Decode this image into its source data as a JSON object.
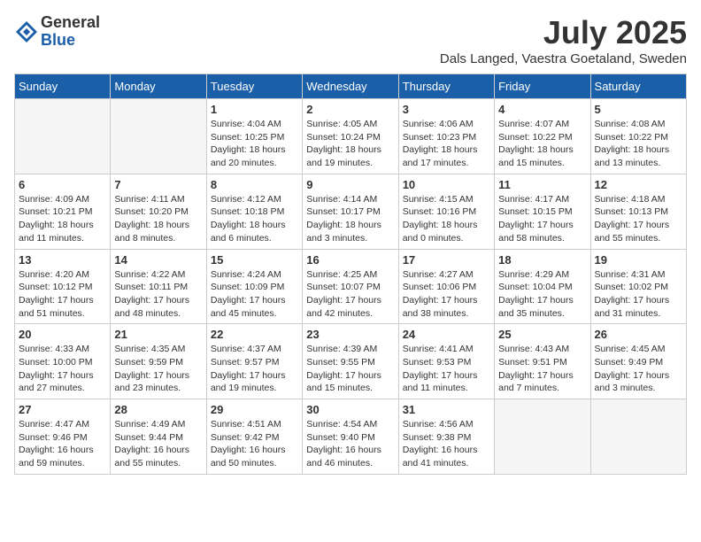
{
  "header": {
    "logo_general": "General",
    "logo_blue": "Blue",
    "month_title": "July 2025",
    "location": "Dals Langed, Vaestra Goetaland, Sweden"
  },
  "weekdays": [
    "Sunday",
    "Monday",
    "Tuesday",
    "Wednesday",
    "Thursday",
    "Friday",
    "Saturday"
  ],
  "weeks": [
    [
      {
        "day": "",
        "info": ""
      },
      {
        "day": "",
        "info": ""
      },
      {
        "day": "1",
        "info": "Sunrise: 4:04 AM\nSunset: 10:25 PM\nDaylight: 18 hours\nand 20 minutes."
      },
      {
        "day": "2",
        "info": "Sunrise: 4:05 AM\nSunset: 10:24 PM\nDaylight: 18 hours\nand 19 minutes."
      },
      {
        "day": "3",
        "info": "Sunrise: 4:06 AM\nSunset: 10:23 PM\nDaylight: 18 hours\nand 17 minutes."
      },
      {
        "day": "4",
        "info": "Sunrise: 4:07 AM\nSunset: 10:22 PM\nDaylight: 18 hours\nand 15 minutes."
      },
      {
        "day": "5",
        "info": "Sunrise: 4:08 AM\nSunset: 10:22 PM\nDaylight: 18 hours\nand 13 minutes."
      }
    ],
    [
      {
        "day": "6",
        "info": "Sunrise: 4:09 AM\nSunset: 10:21 PM\nDaylight: 18 hours\nand 11 minutes."
      },
      {
        "day": "7",
        "info": "Sunrise: 4:11 AM\nSunset: 10:20 PM\nDaylight: 18 hours\nand 8 minutes."
      },
      {
        "day": "8",
        "info": "Sunrise: 4:12 AM\nSunset: 10:18 PM\nDaylight: 18 hours\nand 6 minutes."
      },
      {
        "day": "9",
        "info": "Sunrise: 4:14 AM\nSunset: 10:17 PM\nDaylight: 18 hours\nand 3 minutes."
      },
      {
        "day": "10",
        "info": "Sunrise: 4:15 AM\nSunset: 10:16 PM\nDaylight: 18 hours\nand 0 minutes."
      },
      {
        "day": "11",
        "info": "Sunrise: 4:17 AM\nSunset: 10:15 PM\nDaylight: 17 hours\nand 58 minutes."
      },
      {
        "day": "12",
        "info": "Sunrise: 4:18 AM\nSunset: 10:13 PM\nDaylight: 17 hours\nand 55 minutes."
      }
    ],
    [
      {
        "day": "13",
        "info": "Sunrise: 4:20 AM\nSunset: 10:12 PM\nDaylight: 17 hours\nand 51 minutes."
      },
      {
        "day": "14",
        "info": "Sunrise: 4:22 AM\nSunset: 10:11 PM\nDaylight: 17 hours\nand 48 minutes."
      },
      {
        "day": "15",
        "info": "Sunrise: 4:24 AM\nSunset: 10:09 PM\nDaylight: 17 hours\nand 45 minutes."
      },
      {
        "day": "16",
        "info": "Sunrise: 4:25 AM\nSunset: 10:07 PM\nDaylight: 17 hours\nand 42 minutes."
      },
      {
        "day": "17",
        "info": "Sunrise: 4:27 AM\nSunset: 10:06 PM\nDaylight: 17 hours\nand 38 minutes."
      },
      {
        "day": "18",
        "info": "Sunrise: 4:29 AM\nSunset: 10:04 PM\nDaylight: 17 hours\nand 35 minutes."
      },
      {
        "day": "19",
        "info": "Sunrise: 4:31 AM\nSunset: 10:02 PM\nDaylight: 17 hours\nand 31 minutes."
      }
    ],
    [
      {
        "day": "20",
        "info": "Sunrise: 4:33 AM\nSunset: 10:00 PM\nDaylight: 17 hours\nand 27 minutes."
      },
      {
        "day": "21",
        "info": "Sunrise: 4:35 AM\nSunset: 9:59 PM\nDaylight: 17 hours\nand 23 minutes."
      },
      {
        "day": "22",
        "info": "Sunrise: 4:37 AM\nSunset: 9:57 PM\nDaylight: 17 hours\nand 19 minutes."
      },
      {
        "day": "23",
        "info": "Sunrise: 4:39 AM\nSunset: 9:55 PM\nDaylight: 17 hours\nand 15 minutes."
      },
      {
        "day": "24",
        "info": "Sunrise: 4:41 AM\nSunset: 9:53 PM\nDaylight: 17 hours\nand 11 minutes."
      },
      {
        "day": "25",
        "info": "Sunrise: 4:43 AM\nSunset: 9:51 PM\nDaylight: 17 hours\nand 7 minutes."
      },
      {
        "day": "26",
        "info": "Sunrise: 4:45 AM\nSunset: 9:49 PM\nDaylight: 17 hours\nand 3 minutes."
      }
    ],
    [
      {
        "day": "27",
        "info": "Sunrise: 4:47 AM\nSunset: 9:46 PM\nDaylight: 16 hours\nand 59 minutes."
      },
      {
        "day": "28",
        "info": "Sunrise: 4:49 AM\nSunset: 9:44 PM\nDaylight: 16 hours\nand 55 minutes."
      },
      {
        "day": "29",
        "info": "Sunrise: 4:51 AM\nSunset: 9:42 PM\nDaylight: 16 hours\nand 50 minutes."
      },
      {
        "day": "30",
        "info": "Sunrise: 4:54 AM\nSunset: 9:40 PM\nDaylight: 16 hours\nand 46 minutes."
      },
      {
        "day": "31",
        "info": "Sunrise: 4:56 AM\nSunset: 9:38 PM\nDaylight: 16 hours\nand 41 minutes."
      },
      {
        "day": "",
        "info": ""
      },
      {
        "day": "",
        "info": ""
      }
    ]
  ]
}
